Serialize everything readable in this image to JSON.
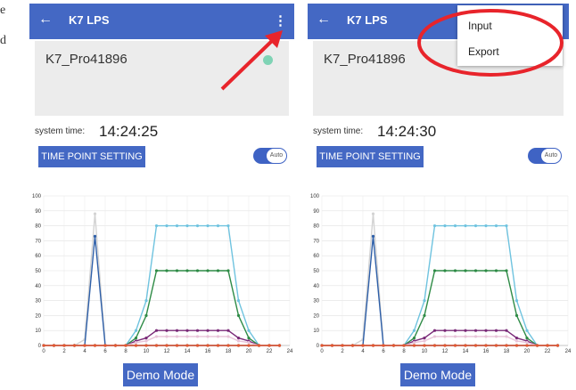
{
  "edge_chars": [
    "e",
    "d"
  ],
  "screens": [
    {
      "appbar": {
        "title": "K7 LPS",
        "back_icon": "back-arrow-icon",
        "menu_icon": "kebab-menu-icon"
      },
      "device_name": "K7_Pro41896",
      "status_color": "#7fd3b5",
      "system_time_label": "system time:",
      "system_time": "14:24:25",
      "time_point_button": "TIME POINT SETTING",
      "toggle_label": "Auto",
      "demo_button": "Demo Mode"
    },
    {
      "appbar": {
        "title": "K7 LPS",
        "back_icon": "back-arrow-icon"
      },
      "device_name": "K7_Pro41896",
      "system_time_label": "system time:",
      "system_time": "14:24:30",
      "time_point_button": "TIME POINT SETTING",
      "toggle_label": "Auto",
      "demo_button": "Demo Mode",
      "menu": {
        "items": [
          "Input",
          "Export"
        ]
      }
    }
  ],
  "chart_data": {
    "type": "line",
    "x": [
      0,
      1,
      2,
      3,
      4,
      5,
      6,
      7,
      8,
      9,
      10,
      11,
      12,
      13,
      14,
      15,
      16,
      17,
      18,
      19,
      20,
      21,
      22,
      23
    ],
    "ylim": [
      0,
      100
    ],
    "xlim": [
      0,
      24
    ],
    "xticks": [
      0,
      2,
      4,
      6,
      8,
      10,
      12,
      14,
      16,
      18,
      20,
      22,
      24
    ],
    "yticks": [
      0,
      10,
      20,
      30,
      40,
      50,
      60,
      70,
      80,
      90,
      100
    ],
    "grid": true,
    "series": [
      {
        "color": "#d3d3d3",
        "values": [
          0,
          0,
          0,
          0,
          4,
          88,
          0,
          0,
          0,
          0,
          0,
          0,
          0,
          0,
          0,
          0,
          0,
          0,
          0,
          0,
          0,
          0,
          0,
          0
        ]
      },
      {
        "color": "#2e5fa8",
        "values": [
          0,
          0,
          0,
          0,
          0,
          73,
          0,
          0,
          0,
          0,
          0,
          0,
          0,
          0,
          0,
          0,
          0,
          0,
          0,
          0,
          0,
          0,
          0,
          0
        ]
      },
      {
        "color": "#6fc3df",
        "values": [
          0,
          0,
          0,
          0,
          0,
          0,
          0,
          0,
          0,
          10,
          30,
          80,
          80,
          80,
          80,
          80,
          80,
          80,
          80,
          30,
          10,
          0,
          0,
          0
        ]
      },
      {
        "color": "#2e8b46",
        "values": [
          0,
          0,
          0,
          0,
          0,
          0,
          0,
          0,
          0,
          5,
          20,
          50,
          50,
          50,
          50,
          50,
          50,
          50,
          50,
          20,
          5,
          0,
          0,
          0
        ]
      },
      {
        "color": "#7a2a78",
        "values": [
          0,
          0,
          0,
          0,
          0,
          0,
          0,
          0,
          0,
          3,
          5,
          10,
          10,
          10,
          10,
          10,
          10,
          10,
          10,
          5,
          3,
          0,
          0,
          0
        ]
      },
      {
        "color": "#e8c3d8",
        "values": [
          0,
          0,
          0,
          0,
          0,
          0,
          0,
          0,
          0,
          2,
          3,
          6,
          6,
          6,
          6,
          6,
          6,
          6,
          6,
          3,
          2,
          0,
          0,
          0
        ]
      },
      {
        "color": "#e4572e",
        "values": [
          0,
          0,
          0,
          0,
          0,
          0,
          0,
          0,
          0,
          0,
          0,
          0,
          0,
          0,
          0,
          0,
          0,
          0,
          0,
          0,
          0,
          0,
          0,
          0
        ]
      }
    ]
  }
}
